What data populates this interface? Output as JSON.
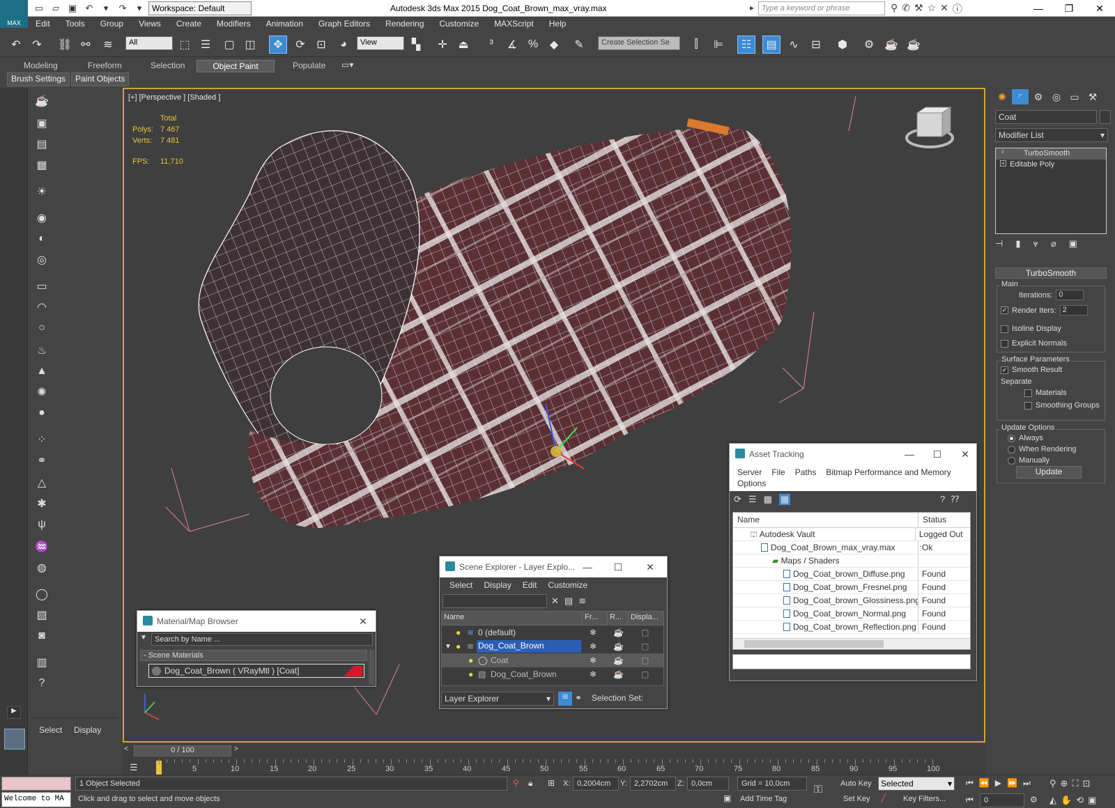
{
  "app": {
    "title": "Autodesk 3ds Max  2015     Dog_Coat_Brown_max_vray.max",
    "logo_text": "MAX",
    "workspace": "Workspace: Default",
    "keyword_placeholder": "Type a keyword or phrase"
  },
  "menu": [
    "Edit",
    "Tools",
    "Group",
    "Views",
    "Create",
    "Modifiers",
    "Animation",
    "Graph Editors",
    "Rendering",
    "Customize",
    "MAXScript",
    "Help"
  ],
  "toolbar": {
    "filter_value": "All",
    "refcoord_value": "View",
    "selection_set_placeholder": "Create Selection Se"
  },
  "ribbon": {
    "tabs": [
      "Modeling",
      "Freeform",
      "Selection",
      "Object Paint",
      "Populate"
    ],
    "active_tab": "Object Paint",
    "sub": [
      "Brush Settings",
      "Paint Objects"
    ]
  },
  "viewport": {
    "label": "[+] [Perspective ] [Shaded ]",
    "stats": {
      "total_label": "Total",
      "polys_label": "Polys:",
      "polys": "7 467",
      "verts_label": "Verts:",
      "verts": "7 481",
      "fps_label": "FPS:",
      "fps": "11,710"
    }
  },
  "command_panel": {
    "object_name": "Coat",
    "modifier_list": "Modifier List",
    "stack": [
      "TurboSmooth",
      "Editable Poly"
    ],
    "rollout": "TurboSmooth",
    "main_label": "Main",
    "iterations_label": "Iterations:",
    "iterations": "0",
    "render_iters_label": "Render Iters:",
    "render_iters": "2",
    "isoline": "Isoline Display",
    "explicit_normals": "Explicit Normals",
    "surface_params": "Surface Parameters",
    "smooth_result": "Smooth Result",
    "separate": "Separate",
    "materials": "Materials",
    "smoothing_groups": "Smoothing Groups",
    "update_options": "Update Options",
    "always": "Always",
    "when_rendering": "When Rendering",
    "manually": "Manually",
    "update_btn": "Update"
  },
  "asset_tracking": {
    "title": "Asset Tracking",
    "menu": [
      "Server",
      "File",
      "Paths",
      "Bitmap Performance and Memory"
    ],
    "menu2": "Options",
    "col_name": "Name",
    "col_status": "Status",
    "rows": [
      {
        "name": "Autodesk Vault",
        "status": "Logged Out ."
      },
      {
        "name": "Dog_Coat_Brown_max_vray.max",
        "status": "Ok"
      },
      {
        "name": "Maps / Shaders",
        "status": ""
      },
      {
        "name": "Dog_Coat_brown_Diffuse.png",
        "status": "Found"
      },
      {
        "name": "Dog_Coat_brown_Fresnel.png",
        "status": "Found"
      },
      {
        "name": "Dog_Coat_brown_Glossiness.png",
        "status": "Found"
      },
      {
        "name": "Dog_Coat_brown_Normal.png",
        "status": "Found"
      },
      {
        "name": "Dog_Coat_brown_Reflection.png",
        "status": "Found"
      }
    ]
  },
  "scene_explorer": {
    "title": "Scene Explorer - Layer Explo...",
    "menu": [
      "Select",
      "Display",
      "Edit",
      "Customize"
    ],
    "col_name": "Name",
    "col_fr": "Fr...",
    "col_r": "R...",
    "col_disp": "Displa...",
    "rows": [
      "0 (default)",
      "Dog_Coat_Brown",
      "Coat",
      "Dog_Coat_Brown"
    ],
    "footer_mode": "Layer Explorer",
    "selection_set": "Selection Set:"
  },
  "material_browser": {
    "title": "Material/Map Browser",
    "search_placeholder": "Search by Name ...",
    "group": "- Scene Materials",
    "item": "Dog_Coat_Brown  ( VRayMtl )  [Coat]"
  },
  "left_panel": {
    "select": "Select",
    "display": "Display"
  },
  "timeline": {
    "frame": "0 / 100",
    "ticks": [
      "0",
      "5",
      "10",
      "15",
      "20",
      "25",
      "30",
      "35",
      "40",
      "45",
      "50",
      "55",
      "60",
      "65",
      "70",
      "75",
      "80",
      "85",
      "90",
      "95",
      "100"
    ]
  },
  "status": {
    "welcome": "Welcome to MA",
    "selected": "1 Object Selected",
    "hint": "Click and drag to select and move objects",
    "x_label": "X:",
    "x": "0,2004cm",
    "y_label": "Y:",
    "y": "2,2702cm",
    "z_label": "Z:",
    "z": "0,0cm",
    "grid": "Grid = 10,0cm",
    "add_time_tag": "Add Time Tag",
    "auto_key": "Auto Key",
    "set_key": "Set Key",
    "key_mode": "Selected",
    "key_filters": "Key Filters...",
    "frame": "0"
  }
}
